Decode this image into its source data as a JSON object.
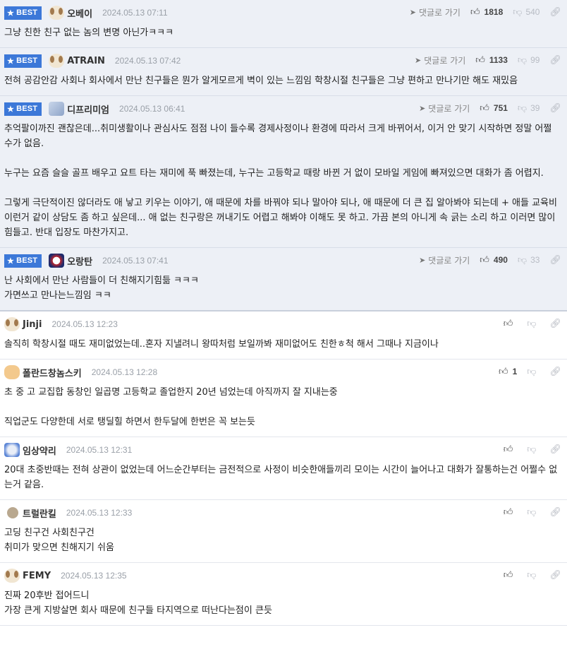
{
  "labels": {
    "best": "BEST",
    "reply": "댓글로 가기"
  },
  "comments": [
    {
      "best": true,
      "avatar": "puppy-avatar",
      "nick": "오베이",
      "date": "2024.05.13 07:11",
      "up": "1818",
      "down": "540",
      "lines": [
        "그냥 친한 친구 없는 놈의 변명 아닌가ㅋㅋㅋ"
      ]
    },
    {
      "best": true,
      "avatar": "puppy-avatar",
      "nick": "ATRAIN",
      "date": "2024.05.13 07:42",
      "up": "1133",
      "down": "99",
      "lines": [
        "전혀 공감안감 사회나 회사에서 만난 친구들은 뭔가 알게모르게 벽이 있는 느낌임 학창시절 친구들은 그냥 편하고 만나기만 해도 재밌음"
      ]
    },
    {
      "best": true,
      "avatar": "cube-avatar",
      "nick": "디프리미엄",
      "date": "2024.05.13 06:41",
      "up": "751",
      "down": "39",
      "lines": [
        "추억팔이까진 괜찮은데...취미생활이나 관심사도 점점 나이 들수록 경제사정이나 환경에 따라서 크게 바뀌어서, 이거 안 맞기 시작하면 정말 어쩔 수가 없음.",
        "",
        "누구는 요즘 슬슬 골프 배우고 요트 타는 재미에 푹 빠졌는데, 누구는 고등학교 때랑 바뀐 거 없이 모바일 게임에 빠져있으면 대화가 좀 어렵지.",
        "",
        "그렇게 극단적이진 않더라도 애 낳고 키우는 이야기, 애 때문에 차를 바꿔야 되나 말아야 되나, 애 때문에 더 큰 집 알아봐야 되는데 + 애들 교육비 이런거 같이 상담도 좀 하고 싶은데... 애 없는 친구랑은 꺼내기도 어렵고 해봐야 이해도 못 하고. 가끔 본의 아니게 속 긁는 소리 하고 이러면 많이 힘들고. 반대 입장도 마찬가지고."
      ]
    },
    {
      "best": true,
      "avatar": "mask-avatar",
      "nick": "오랑탄",
      "date": "2024.05.13 07:41",
      "up": "490",
      "down": "33",
      "lines": [
        "난 사회에서 만난 사람들이 더 친해지기힘듦 ㅋㅋㅋ",
        "가면쓰고 만나는느낌임 ㅋㅋ"
      ]
    },
    {
      "best": false,
      "avatar": "puppy-avatar",
      "nick": "Jinji",
      "date": "2024.05.13 12:23",
      "up": "",
      "down": "",
      "lines": [
        "솔직히 학창시절 때도 재미없었는데..혼자 지낼려니 왕따처럼 보일까봐 재미없어도 친한ㅎ척 해서 그때나 지금이나"
      ]
    },
    {
      "best": false,
      "avatar": "fox-avatar",
      "nick": "폴란드창놈스키",
      "date": "2024.05.13 12:28",
      "up": "1",
      "down": "",
      "lines": [
        "초 중 고 교집합 동창인 일곱명 고등학교 졸업한지 20년 넘었는데 아직까지 잘 지내는중",
        "",
        "직업군도 다양한데 서로 탱딜힐 하면서 한두달에 한번은 꼭 보는듯"
      ]
    },
    {
      "best": false,
      "avatar": "blob-avatar",
      "nick": "임상약리",
      "date": "2024.05.13 12:31",
      "up": "",
      "down": "",
      "lines": [
        "20대 초중반때는 전혀 상관이 없었는데 어느순간부터는 금전적으로 사정이 비슷한애들끼리 모이는 시간이 늘어나고 대화가 잘통하는건 어쩔수 없는거 같음."
      ]
    },
    {
      "best": false,
      "avatar": "dot-avatar",
      "nick": "트럴란킬",
      "date": "2024.05.13 12:33",
      "up": "",
      "down": "",
      "lines": [
        "고딩 친구건 사회친구건",
        "취미가 맞으면 친해지기 쉬움"
      ]
    },
    {
      "best": false,
      "avatar": "puppy-avatar",
      "nick": "FEMY",
      "date": "2024.05.13 12:35",
      "up": "",
      "down": "",
      "lines": [
        "진짜 20후반 접어드니",
        "가장 큰게 지방살면 회사 때문에 친구들 타지역으로 떠난다는점이 큰듯"
      ]
    }
  ]
}
